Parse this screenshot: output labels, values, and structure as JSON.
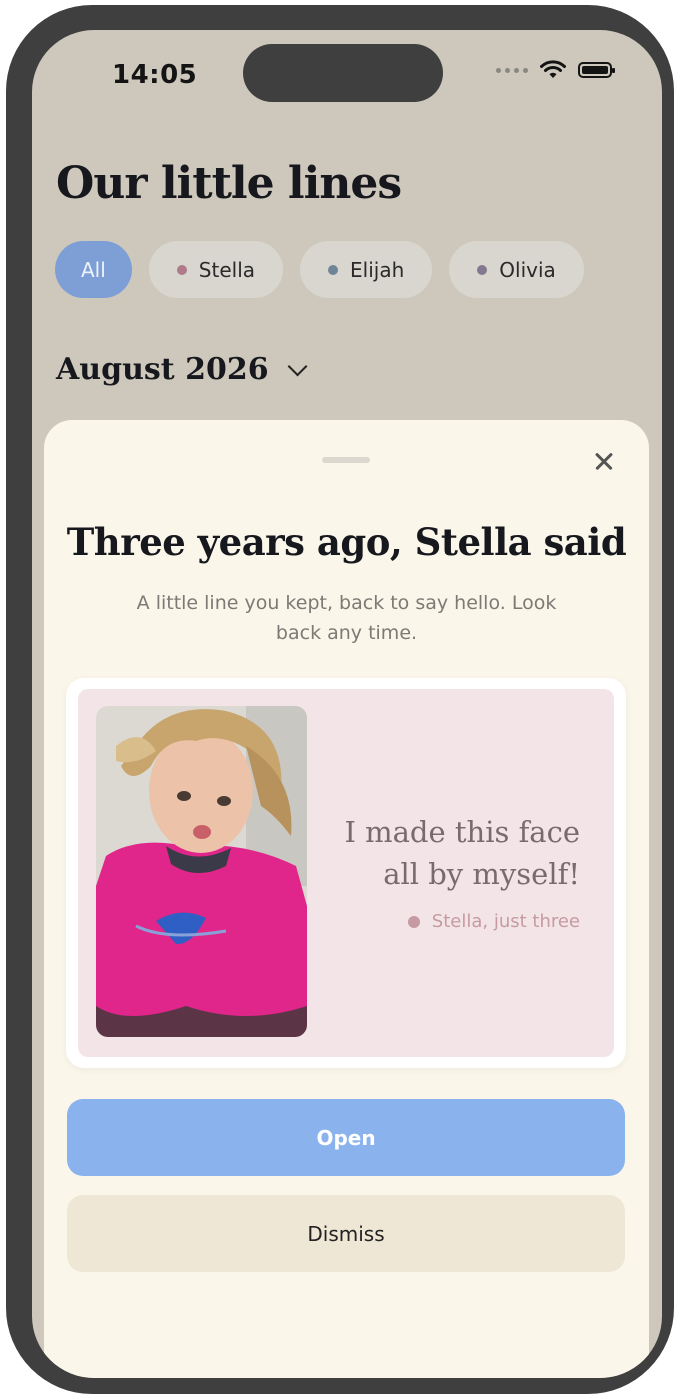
{
  "status_bar": {
    "time": "14:05"
  },
  "header": {
    "title": "Our little lines"
  },
  "filters": [
    {
      "label": "All",
      "active": true
    },
    {
      "label": "Stella",
      "dot_color": "#b07a8a"
    },
    {
      "label": "Elijah",
      "dot_color": "#6f8497"
    },
    {
      "label": "Olivia",
      "dot_color": "#84788e"
    }
  ],
  "month": {
    "label": "August 2026"
  },
  "memory": {
    "title": "Three years ago, Stella said",
    "subtitle": "A little line you kept, back to say hello. Look back any time.",
    "quote": "I made this face all by myself!",
    "attribution": "Stella, just three",
    "attribution_dot_color": "#c69aa3"
  },
  "actions": {
    "open_label": "Open",
    "dismiss_label": "Dismiss"
  },
  "colors": {
    "accent": "#8ab3ee",
    "chip_active": "#7d9fd6",
    "sheet": "#faf6ea",
    "card": "#f3e5e7"
  }
}
